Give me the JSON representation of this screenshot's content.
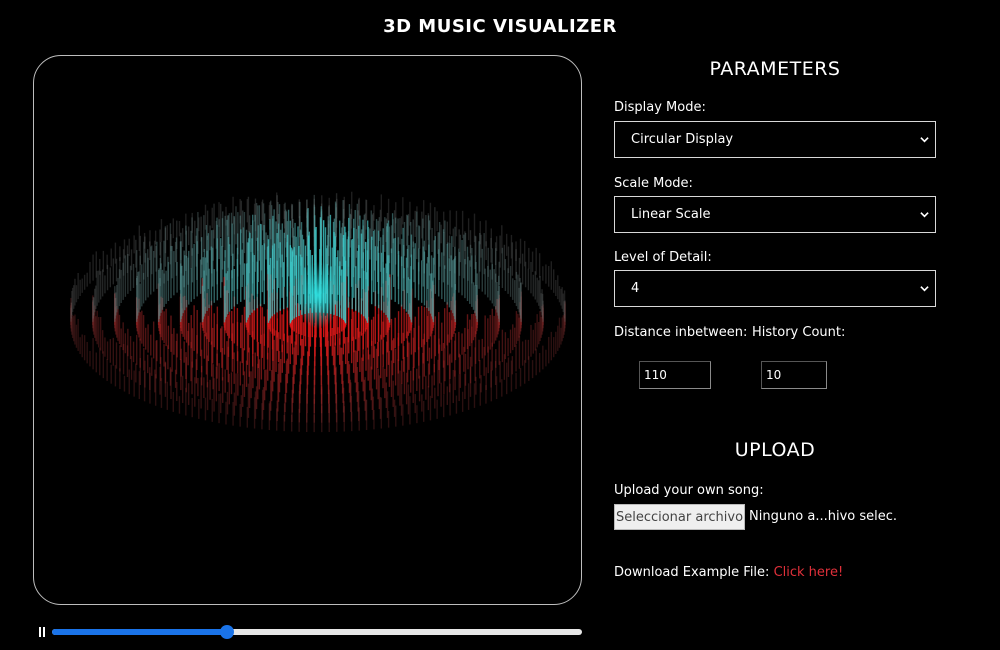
{
  "app": {
    "title": "3D MUSIC VISUALIZER"
  },
  "player": {
    "pause_icon": "pause-icon",
    "progress": 0.33
  },
  "parameters": {
    "title": "PARAMETERS",
    "display_mode": {
      "label": "Display Mode:",
      "value": "Circular Display"
    },
    "scale_mode": {
      "label": "Scale Mode:",
      "value": "Linear Scale"
    },
    "level_of_detail": {
      "label": "Level of Detail:",
      "value": "4"
    },
    "distance": {
      "label": "Distance inbetween:",
      "value": "110"
    },
    "history": {
      "label": "History Count:",
      "value": "10"
    }
  },
  "upload": {
    "title": "UPLOAD",
    "label": "Upload your own song:",
    "button": "Seleccionar archivo",
    "status": "Ninguno a...hivo selec.",
    "download_label": "Download Example File:",
    "download_link": "Click here!"
  },
  "colors": {
    "accent": "#1a73e8",
    "link": "#e0303a",
    "viz_cyan": "#2ee6e6",
    "viz_red": "#e01818"
  }
}
